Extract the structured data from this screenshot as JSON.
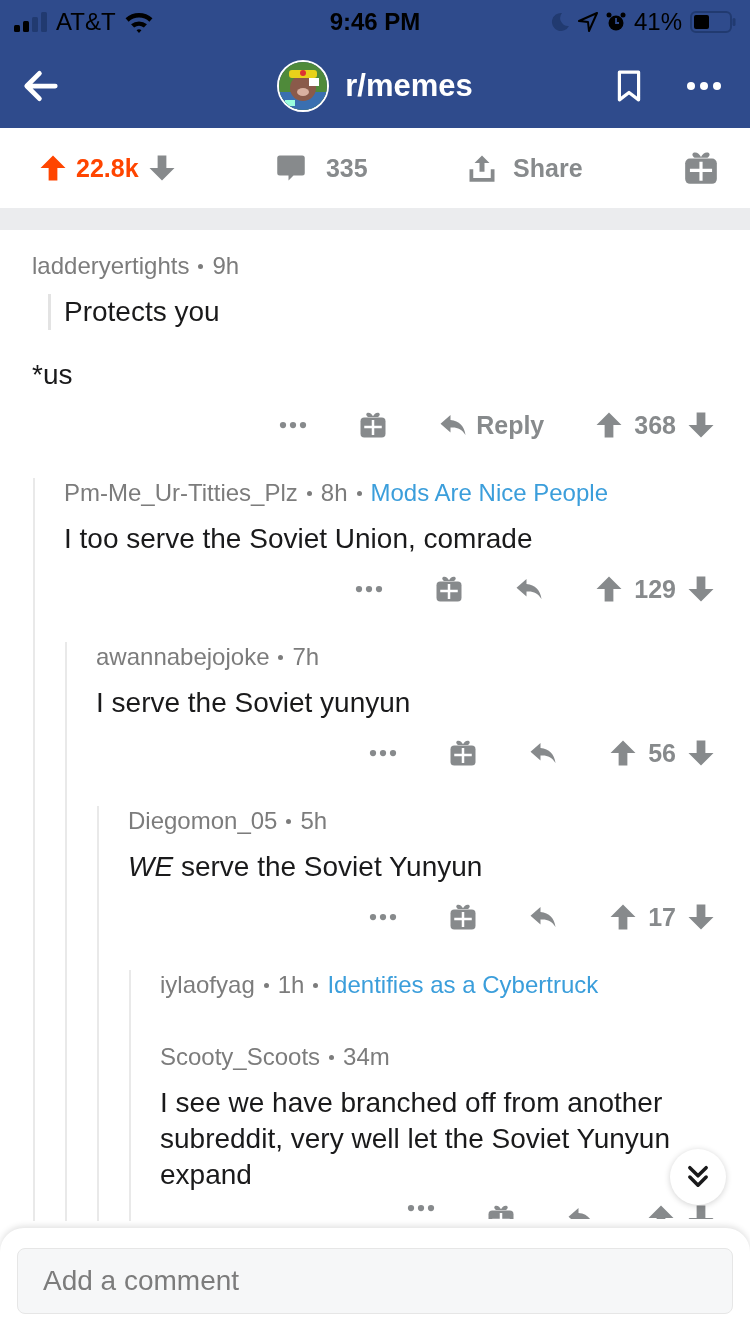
{
  "status_bar": {
    "carrier": "AT&T",
    "time": "9:46 PM",
    "battery": "41%"
  },
  "header": {
    "subreddit": "r/memes"
  },
  "post_actions": {
    "upvoted": true,
    "score": "22.8k",
    "comments": "335",
    "share": "Share"
  },
  "comments": [
    {
      "author": "ladderyertights",
      "time": "9h",
      "body": [
        {
          "kind": "quote",
          "text": "Protects you"
        },
        {
          "kind": "text",
          "text": "*us"
        }
      ],
      "actions": {
        "reply_label": "Reply",
        "score": "368"
      },
      "children": [
        {
          "author": "Pm-Me_Ur-Titties_Plz",
          "time": "8h",
          "flair": "Mods Are Nice People",
          "body": [
            {
              "kind": "text",
              "text": "I too serve the Soviet Union, comrade"
            }
          ],
          "actions": {
            "score": "129"
          },
          "children": [
            {
              "author": "awannabejojoke",
              "time": "7h",
              "body": [
                {
                  "kind": "text",
                  "text": "I serve the Soviet yunyun"
                }
              ],
              "actions": {
                "score": "56"
              },
              "children": [
                {
                  "author": "Diegomon_05",
                  "time": "5h",
                  "body": [
                    {
                      "kind": "text",
                      "text": "*WE* serve the Soviet Yunyun"
                    }
                  ],
                  "actions": {
                    "score": "17"
                  },
                  "children": [
                    {
                      "author": "iylaofyag",
                      "time": "1h",
                      "flair": "Identifies as a Cybertruck"
                    },
                    {
                      "author": "Scooty_Scoots",
                      "time": "34m",
                      "body": [
                        {
                          "kind": "text",
                          "text": "I see we have branched off from another subreddit, very well let the Soviet Yunyun expand"
                        }
                      ],
                      "actions": {
                        "cut_off": true
                      }
                    }
                  ]
                }
              ]
            }
          ]
        }
      ]
    }
  ],
  "composer": {
    "placeholder": "Add a comment"
  }
}
